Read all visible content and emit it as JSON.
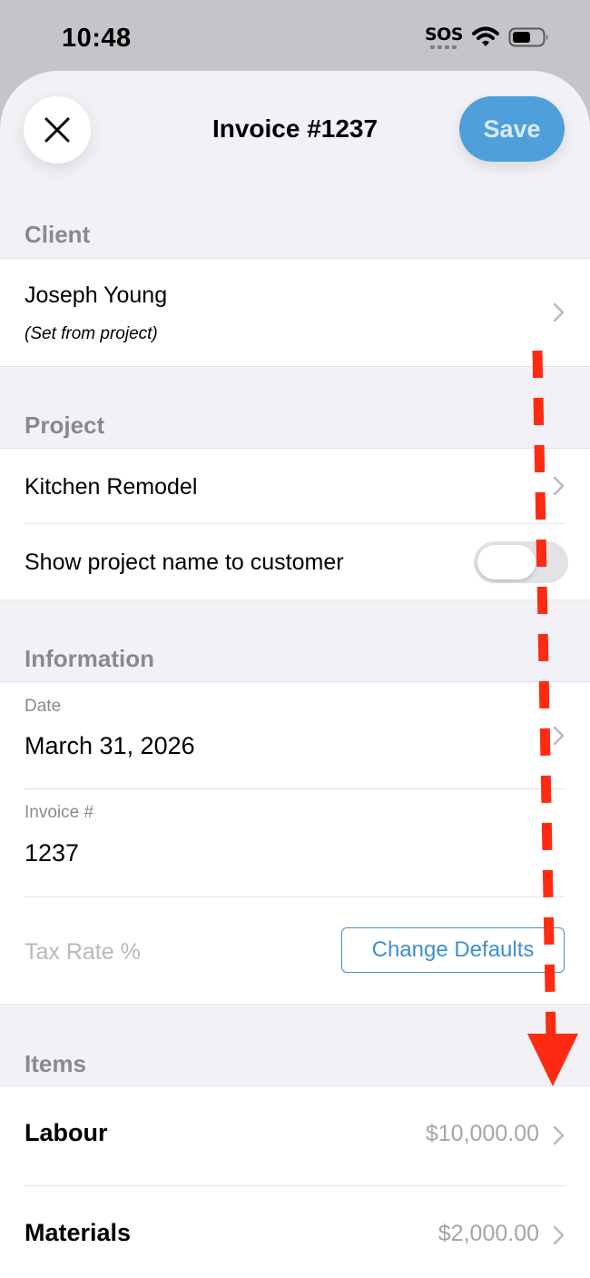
{
  "status_bar": {
    "time": "10:48",
    "sos": "SOS",
    "icons": [
      "wifi-icon",
      "battery-icon"
    ]
  },
  "header": {
    "close_icon": "close-icon",
    "title": "Invoice #1237",
    "save_label": "Save"
  },
  "client": {
    "header": "Client",
    "name": "Joseph Young",
    "note": "(Set from project)"
  },
  "project": {
    "header": "Project",
    "name": "Kitchen Remodel",
    "show_name_label": "Show project name to customer",
    "show_name_enabled": false
  },
  "information": {
    "header": "Information",
    "date_label": "Date",
    "date_value": "March 31, 2026",
    "invoice_label": "Invoice #",
    "invoice_value": "1237",
    "tax_placeholder": "Tax Rate %",
    "change_defaults_label": "Change Defaults"
  },
  "items": {
    "header": "Items",
    "list": [
      {
        "name": "Labour",
        "amount": "$10,000.00"
      },
      {
        "name": "Materials",
        "amount": "$2,000.00"
      }
    ]
  },
  "colors": {
    "accent": "#4f9fdb",
    "link": "#3f8fd2",
    "annotation_arrow": "#ff2a12",
    "section_background": "#f1f1f6"
  }
}
